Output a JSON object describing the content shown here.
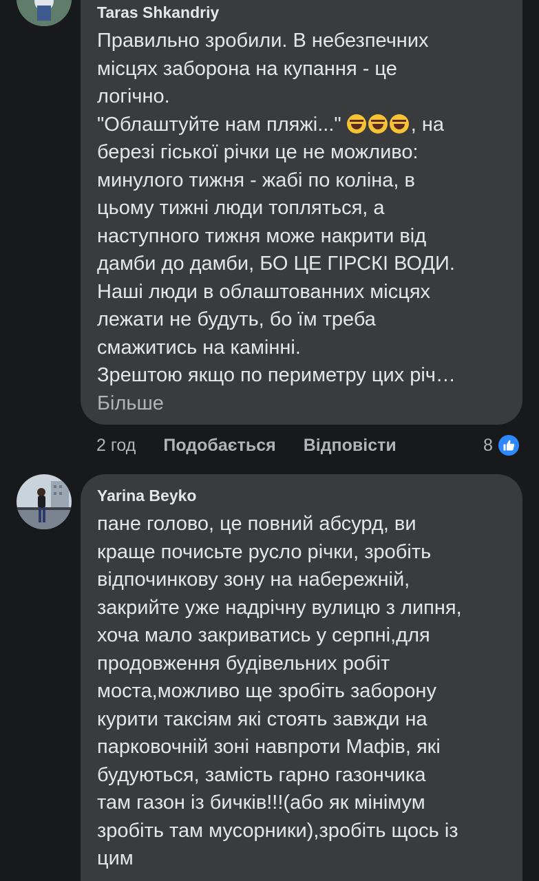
{
  "comments": [
    {
      "author": "Taras Shkandriy",
      "lines": [
        "Правильно зробили. В небезпечних",
        "місцях заборона на купання - це",
        "логічно.",
        "\"Облаштуйте нам пляжі...\" ",
        "березі гіської річки це не можливо:",
        "минулого тижня - жабі по коліна, в",
        "цьому тижні люди топляться, а",
        "наступного тижня може накрити від",
        "дамби до дамби, БО ЦЕ ГІРСКІ ВОДИ.",
        "Наші люди в облаштованних місцях",
        "лежати не будуть, бо їм треба",
        "смажитись на камінні.",
        "Зрештою якщо по периметру цих річ…"
      ],
      "line4_suffix": ", на",
      "emoji_icon": "rolling-on-the-floor-laughing-emoji",
      "more_label": "Більше",
      "time": "2 год",
      "like_label": "Подобається",
      "reply_label": "Відповісти",
      "reaction_count": "8",
      "reaction_icon": "like-icon"
    },
    {
      "author": "Yarina Beyko",
      "lines": [
        "пане голово, це повний абсурд, ви",
        "краще почисьте русло річки, зробіть",
        "відпочинкову зону на набережній,",
        "закрийте уже надрічну вулицю з липня,",
        "хоча мало закриватись у серпні,для",
        "продовження будівельних робіт",
        "моста,можливо ще зробіть  заборону",
        "курити таксіям які стоять завжди на",
        "парковочній зоні навпроти Мафів, які",
        "будуються, замість гарно газончика",
        "там газон із бичків!!!(або як мінімум",
        "зробіть там мусорники),зробіть щось із",
        "цим"
      ]
    }
  ],
  "colors": {
    "background": "#18191a",
    "bubble": "#3a3b3c",
    "text": "#e4e6eb",
    "secondary": "#b0b3b8",
    "like_blue": "#2d88ff"
  }
}
